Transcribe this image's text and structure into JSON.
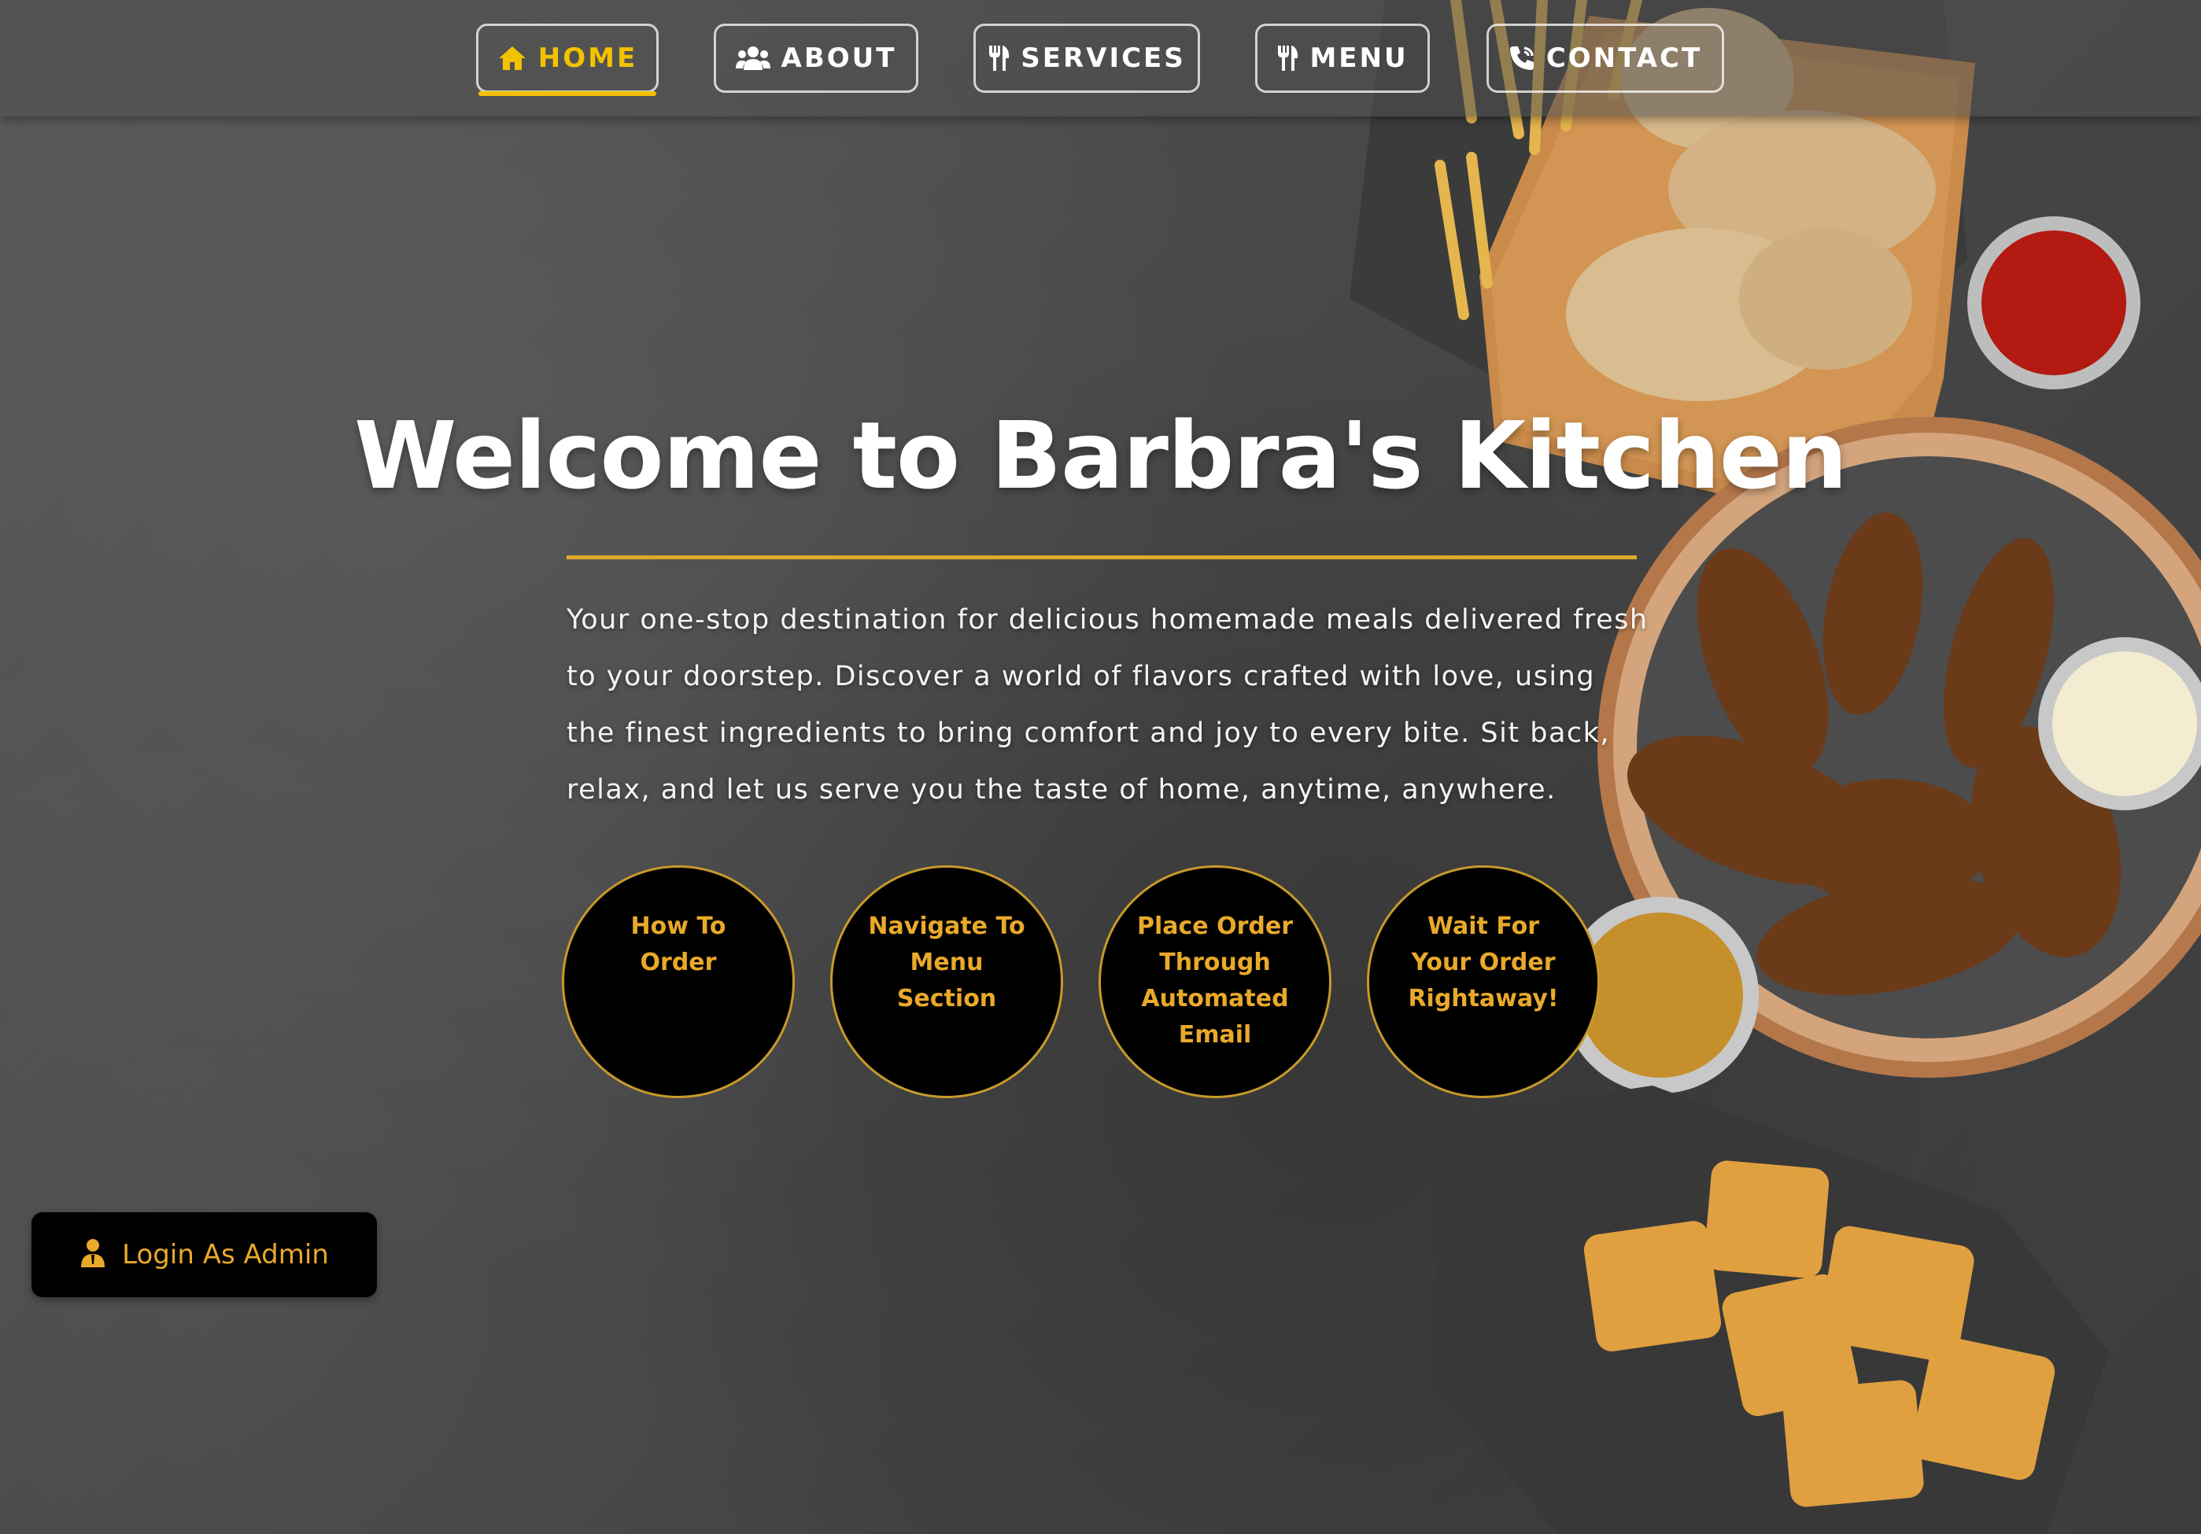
{
  "nav": {
    "items": [
      {
        "label": "HOME",
        "icon": "home-icon",
        "active": true
      },
      {
        "label": "ABOUT",
        "icon": "users-icon",
        "active": false
      },
      {
        "label": "SERVICES",
        "icon": "utensils-icon",
        "active": false
      },
      {
        "label": "MENU",
        "icon": "utensils-icon",
        "active": false
      },
      {
        "label": "CONTACT",
        "icon": "phone-icon",
        "active": false
      }
    ]
  },
  "hero": {
    "title": "Welcome to Barbra's Kitchen",
    "description": "Your one-stop destination for delicious homemade meals delivered fresh to your doorstep. Discover a world of flavors crafted with love, using the finest ingredients to bring comfort and joy to every bite. Sit back, relax, and let us serve you the taste of home, anytime, anywhere."
  },
  "steps": [
    {
      "label": "How To Order"
    },
    {
      "label": "Navigate To Menu Section"
    },
    {
      "label": "Place Order Through Automated Email"
    },
    {
      "label": "Wait For Your Order Rightaway!"
    }
  ],
  "login": {
    "label": "Login As Admin",
    "icon": "admin-user-icon"
  },
  "colors": {
    "accent": "#f2c200",
    "gold": "#e9a92a",
    "circle_bg": "#000000"
  }
}
